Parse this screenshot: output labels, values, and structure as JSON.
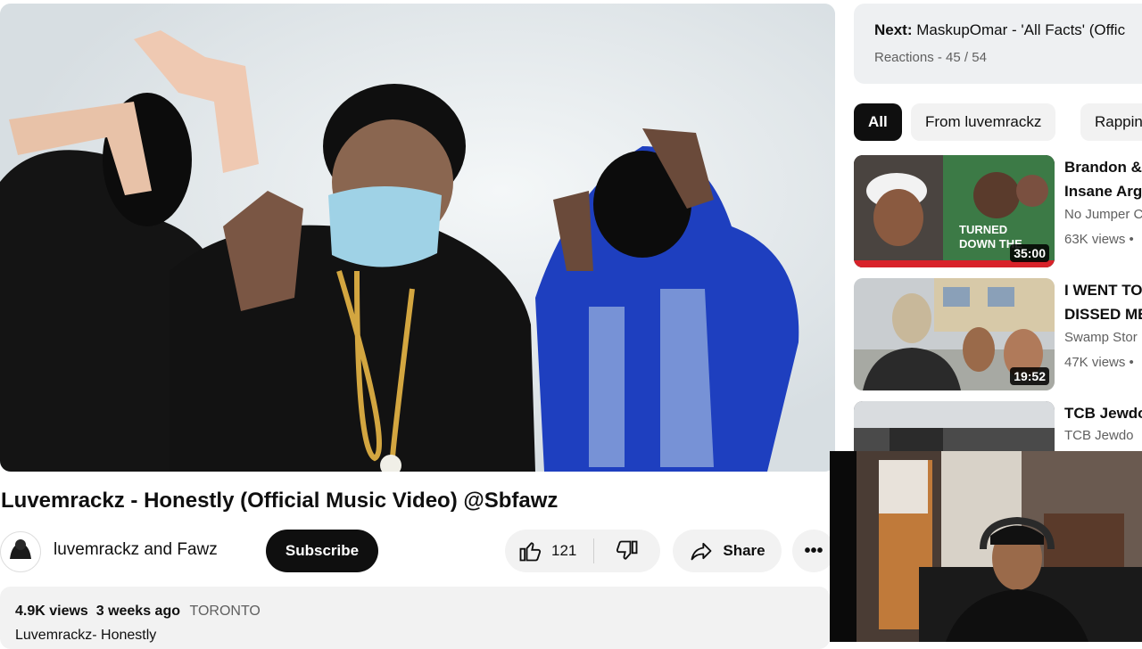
{
  "video": {
    "title": "Luvemrackz - Honestly (Official Music Video) @Sbfawz"
  },
  "channel": {
    "name": "luvemrackz and Fawz",
    "subscribe_label": "Subscribe"
  },
  "actions": {
    "like_count": "121",
    "share_label": "Share",
    "more_label": "•••"
  },
  "description": {
    "views": "4.9K views",
    "date": "3 weeks ago",
    "location": "TORONTO",
    "first_line": "Luvemrackz- Honestly"
  },
  "next": {
    "label": "Next:",
    "title": "MaskupOmar - 'All Facts' (Offic",
    "playlist": "Reactions",
    "position": "45 / 54"
  },
  "chips": [
    "All",
    "From luvemrackz",
    "Rappin"
  ],
  "recommendations": [
    {
      "title_line1": "Brandon &",
      "title_line2": "Insane Arg",
      "channel": "No Jumper C",
      "views": "63K views •",
      "duration": "35:00",
      "thumb_text": "TURNED DOWN THE"
    },
    {
      "title_line1": "I WENT TO",
      "title_line2": "DISSED ME",
      "channel": "Swamp Stor",
      "views": "47K views •",
      "duration": "19:52"
    },
    {
      "title_line1": "TCB Jewdo",
      "channel": "TCB Jewdo"
    }
  ],
  "colors": {
    "subscribe_bg": "#0f0f0f",
    "pill_bg": "#f2f2f2",
    "secondary_text": "#606060",
    "hoodie_blue": "#1e3fbf"
  }
}
